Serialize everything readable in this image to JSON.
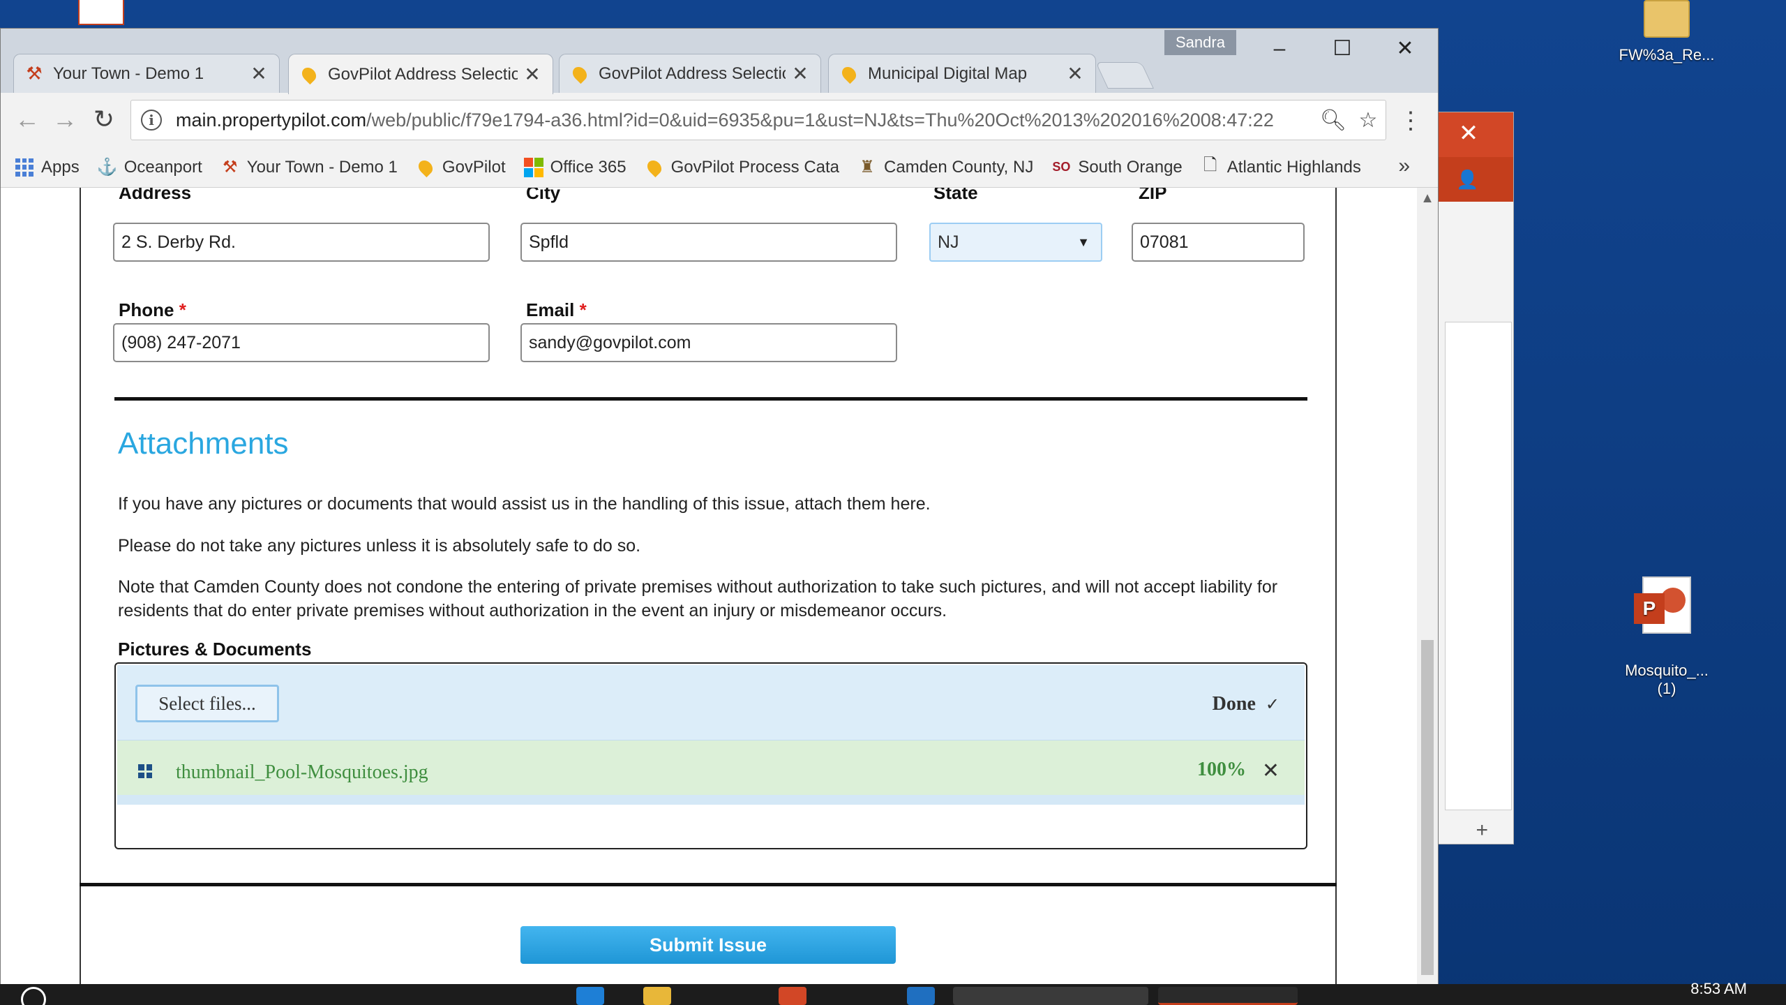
{
  "desktop": {
    "icons": [
      {
        "label": "FW%3a_Re...",
        "icon": "folder-icon"
      },
      {
        "label": "Mosquito_...\n(1)",
        "icon": "powerpoint-file-icon"
      }
    ]
  },
  "browser": {
    "profile": "Sandra",
    "window_controls": {
      "minimize": "–",
      "maximize": "☐",
      "close": "✕"
    },
    "tabs": [
      {
        "title": "Your Town - Demo 1",
        "icon": "town-icon",
        "active": false
      },
      {
        "title": "GovPilot Address Selectio",
        "icon": "govpilot-pin-icon",
        "active": true
      },
      {
        "title": "GovPilot Address Selectio",
        "icon": "govpilot-pin-icon",
        "active": false
      },
      {
        "title": "Municipal Digital Map",
        "icon": "govpilot-pin-icon",
        "active": false
      }
    ],
    "url_host": "main.propertypilot.com",
    "url_path": "/web/public/f79e1794-a36.html?id=0&uid=6935&pu=1&ust=NJ&ts=Thu%20Oct%2013%202016%2008:47:22",
    "bookmarks": [
      {
        "label": "Apps",
        "icon": "apps-grid-icon"
      },
      {
        "label": "Oceanport",
        "icon": "oceanport-icon"
      },
      {
        "label": "Your Town - Demo 1",
        "icon": "town-icon"
      },
      {
        "label": "GovPilot",
        "icon": "govpilot-pin-icon"
      },
      {
        "label": "Office 365",
        "icon": "office-icon"
      },
      {
        "label": "GovPilot Process Cata",
        "icon": "govpilot-pin-icon"
      },
      {
        "label": "Camden County, NJ",
        "icon": "camden-icon"
      },
      {
        "label": "South Orange",
        "icon": "south-orange-icon"
      },
      {
        "label": "Atlantic Highlands",
        "icon": "page-icon"
      }
    ],
    "bookmarks_more": "»"
  },
  "form": {
    "address_label": "Address",
    "address_value": "2 S. Derby Rd.",
    "city_label": "City",
    "city_value": "Spfld",
    "state_label": "State",
    "state_value": "NJ",
    "zip_label": "ZIP",
    "zip_value": "07081",
    "phone_label": "Phone",
    "phone_value": "(908) 247-2071",
    "email_label": "Email",
    "email_value": "sandy@govpilot.com",
    "required_mark": "*"
  },
  "attachments": {
    "title": "Attachments",
    "p1": "If you have any pictures or documents that would assist us in the handling of this issue, attach them here.",
    "p2": "Please do not take any pictures unless it is absolutely safe to do so.",
    "p3": "Note that Camden County does not condone the entering of private premises without authorization to take such pictures, and will not accept liability for residents that do enter private premises without authorization in the event an injury or misdemeanor occurs.",
    "section_label": "Pictures & Documents",
    "select_button": "Select files...",
    "done_label": "Done",
    "file_name": "thumbnail_Pool-Mosquitoes.jpg",
    "file_progress": "100%"
  },
  "submit_label": "Submit Issue",
  "taskbar": {
    "time": "8:53 AM"
  },
  "colors": {
    "accent": "#2aa7e0",
    "success": "#3f8e3f",
    "required": "#e01f1f"
  }
}
